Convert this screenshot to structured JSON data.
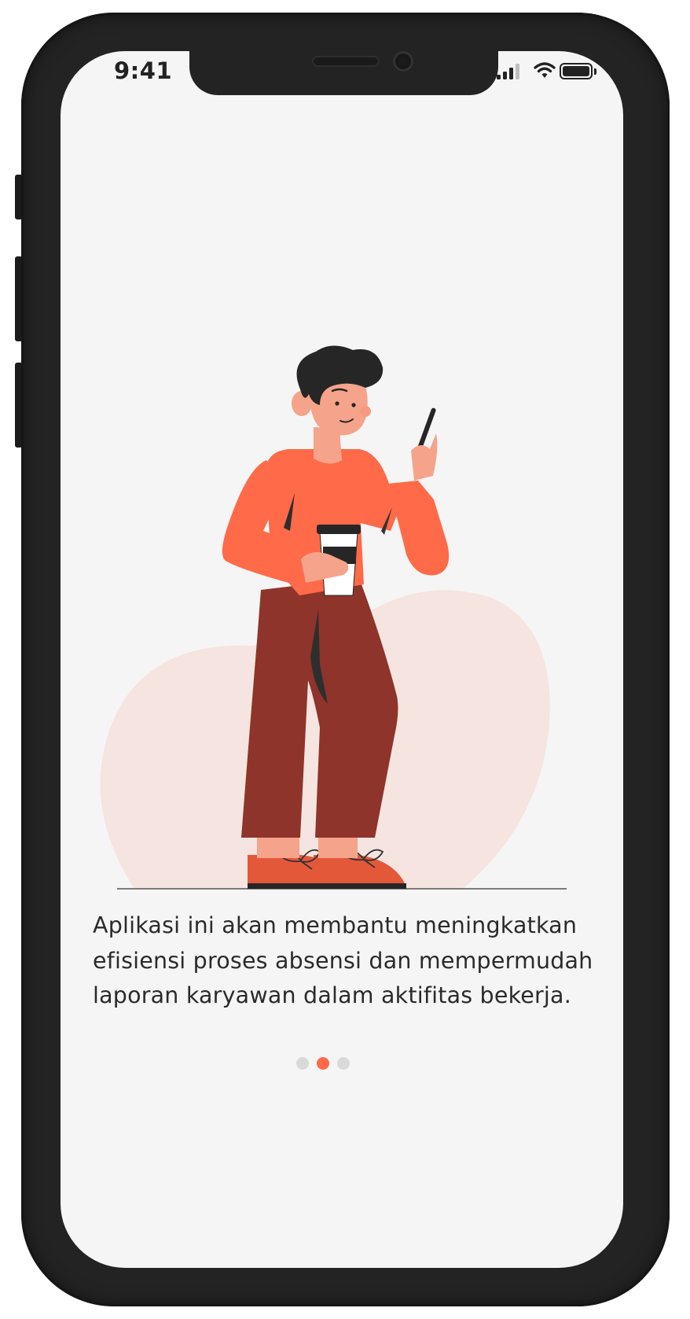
{
  "status_bar": {
    "time": "9:41",
    "signal_icon": "cellular-signal-icon",
    "wifi_icon": "wifi-icon",
    "battery_icon": "battery-icon"
  },
  "onboarding": {
    "description": "Aplikasi ini akan membantu meningkatkan efisiensi proses absensi dan mempermudah laporan karyawan dalam aktifitas bekerja.",
    "pagination": {
      "total": 3,
      "active_index": 1
    }
  },
  "colors": {
    "accent": "#ff6a48",
    "dot_inactive": "#d9d9d9",
    "screen_background": "#f5f5f5",
    "blob": "#f5e4df"
  }
}
